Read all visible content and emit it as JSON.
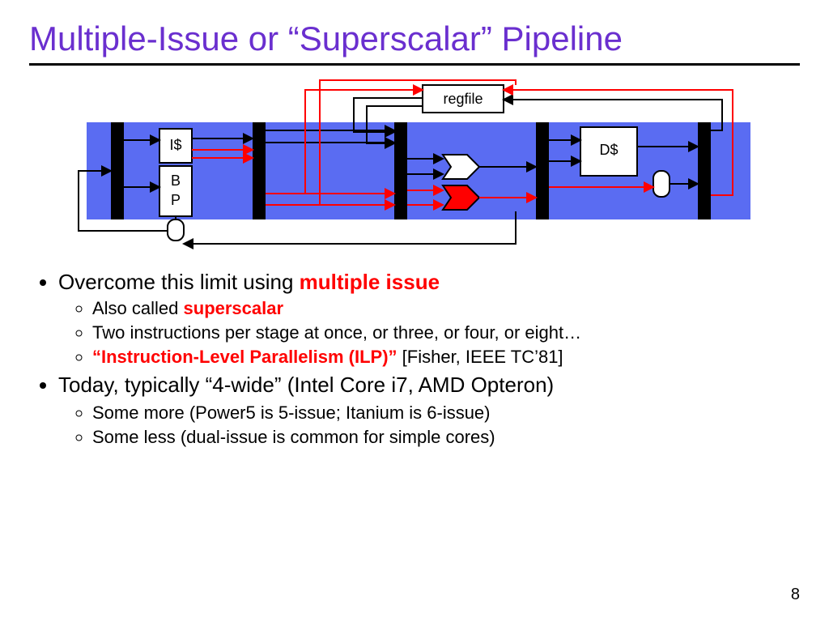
{
  "title": "Multiple-Issue or “Superscalar” Pipeline",
  "diagram": {
    "regfile": "regfile",
    "icache": "I$",
    "bp1": "B",
    "bp2": "P",
    "dcache": "D$",
    "colors": {
      "band": "#5a6cf2",
      "stage": "#000000",
      "box_fill": "#ffffff",
      "wire_black": "#000000",
      "wire_red": "#ff0000",
      "alu_white": "#ffffff",
      "alu_red": "#ff0000"
    }
  },
  "bullets": {
    "b1_pre": "Overcome this limit using ",
    "b1_red": "multiple issue",
    "b1a_pre": "Also called ",
    "b1a_red": "superscalar",
    "b1b": "Two instructions per stage at once, or three, or four, or eight…",
    "b1c_red": "“Instruction-Level Parallelism (ILP)” ",
    "b1c_cite": "[Fisher, IEEE TC’81]",
    "b2": "Today, typically “4-wide” (Intel Core i7, AMD Opteron)",
    "b2a": "Some more (Power5 is 5-issue; Itanium is 6-issue)",
    "b2b": "Some less (dual-issue is common for simple cores)"
  },
  "page_number": "8"
}
